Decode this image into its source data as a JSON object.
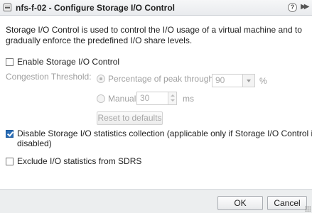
{
  "window": {
    "title": "nfs-f-02 - Configure Storage I/O Control",
    "title_icon": "storage-dialog-icon",
    "help_icon": "help-icon",
    "expand_icon": "double-chevron-right-icon"
  },
  "description": "Storage I/O Control is used to control the I/O usage of a virtual machine and to gradually enforce the predefined I/O share levels.",
  "enable_sioc": {
    "label": "Enable Storage I/O Control",
    "checked": false
  },
  "congestion": {
    "label": "Congestion Threshold:",
    "percentage": {
      "label": "Percentage of peak throughput",
      "value": "90",
      "unit": "%",
      "selected": true
    },
    "manual": {
      "label": "Manual",
      "value": "30",
      "unit": "ms",
      "selected": false
    },
    "reset_label": "Reset to defaults"
  },
  "disable_stats": {
    "label_line1": "Disable Storage I/O statistics collection (applicable only if Storage I/O Control is",
    "label_line2": "disabled)",
    "checked": true
  },
  "exclude_sdrs": {
    "label": "Exclude I/O statistics from SDRS",
    "checked": false
  },
  "footer": {
    "ok_label": "OK",
    "cancel_label": "Cancel"
  },
  "colors": {
    "accent": "#2a6db6",
    "footer_bg": "#eceeef",
    "disabled_text": "#a0a0a0"
  }
}
